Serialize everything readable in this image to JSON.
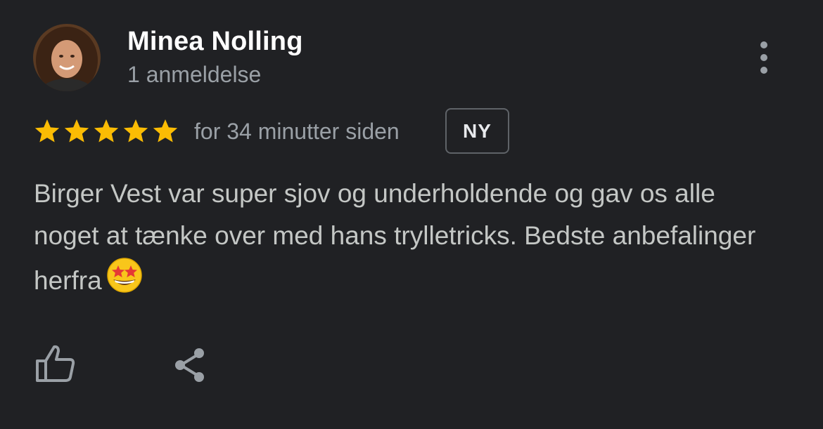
{
  "reviewer": {
    "name": "Minea Nolling",
    "review_count": "1 anmeldelse",
    "avatar_icon": "profile-photo"
  },
  "rating": {
    "stars": 5,
    "max_stars": 5,
    "star_color": "#fbbc04"
  },
  "timestamp": "for 34 minutter siden",
  "badge": "NY",
  "review": {
    "text": "Birger Vest var super sjov og underholdende og gav os alle noget at tænke over med hans trylletricks. Bedste anbefalinger herfra",
    "emoji": "star-struck-emoji"
  },
  "actions": {
    "like_icon": "thumbs-up-icon",
    "share_icon": "share-icon",
    "more_icon": "more-vert-icon"
  },
  "colors": {
    "background": "#202124",
    "secondary_text": "#9aa0a6",
    "body_text": "#c4c7c5"
  }
}
